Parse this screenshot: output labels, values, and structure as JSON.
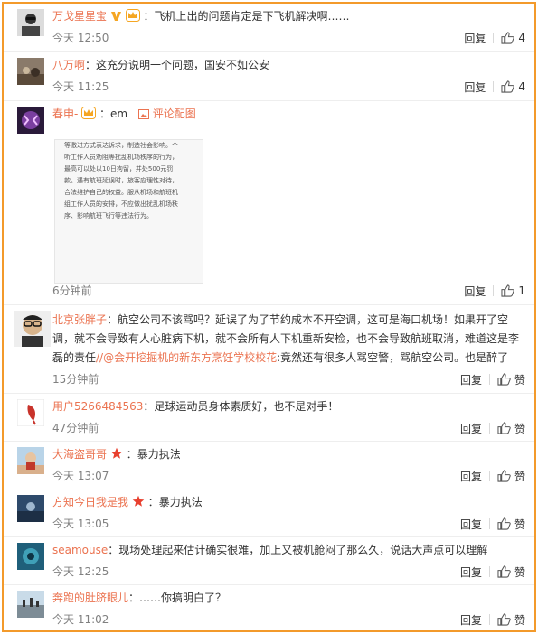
{
  "colors": {
    "frame": "#f39a2b",
    "username": "#eb7350",
    "vip_badge": "#f5a623",
    "star_badge": "#e8402f"
  },
  "comments": [
    {
      "user": "万戈星星宝",
      "sep": "：",
      "text": "飞机上出的问题肯定是下飞机解决啊……",
      "time": "今天 12:50",
      "reply": "回复",
      "likes": "4",
      "badges": [
        "vip-v-icon",
        "member-crown-icon"
      ]
    },
    {
      "user": "八万啊",
      "sep": "：",
      "text": "这充分说明一个问题，国安不如公安",
      "time": "今天 11:25",
      "reply": "回复",
      "likes": "4"
    },
    {
      "user": "春申-",
      "sep": "：",
      "text": "em",
      "pic_link": "评论配图",
      "pic_text": "等激进方式表达诉求，制造社会影响。个\n听工作人员劝阻等扰乱机场秩序的行为，\n最高可以处以10日拘留，并处500元罚\n款。遇有航班延误时，旅客应理性对待，\n合法维护自己的权益。服从机场和航班机\n组工作人员的安排，不应做出扰乱机场秩\n序、影响航班飞行等违法行为。",
      "time": "6分钟前",
      "reply": "回复",
      "likes": "1",
      "badges": [
        "member-crown-icon"
      ]
    },
    {
      "user": "北京张胖子",
      "sep": "：",
      "text": "航空公司不该骂吗？延误了为了节约成本不开空调，这可是海口机场！如果开了空调，就不会导致有人心脏病下机，就不会所有人下机重新安检，也不会导致航班取消，难道这是李磊的责任",
      "mention": "//@会开挖掘机的新东方烹饪学校校花",
      "text2": ":竟然还有很多人骂空警，骂航空公司。也是醉了",
      "time": "15分钟前",
      "reply": "回复",
      "likes": "赞"
    },
    {
      "user": "用户5266484563",
      "sep": "：",
      "text": "足球运动员身体素质好，也不是对手！",
      "time": "47分钟前",
      "reply": "回复",
      "likes": "赞"
    },
    {
      "user": "大海盗哥哥",
      "sep": "：",
      "text": "暴力执法",
      "time": "今天 13:07",
      "reply": "回复",
      "likes": "赞",
      "badges": [
        "star-badge-icon"
      ]
    },
    {
      "user": "方知今日我是我",
      "sep": "：",
      "text": "暴力执法",
      "time": "今天 13:05",
      "reply": "回复",
      "likes": "赞",
      "badges": [
        "star-badge-icon"
      ]
    },
    {
      "user": "seamouse",
      "sep": "：",
      "text": "现场处理起来估计确实很难，加上又被机舱闷了那么久，说话大声点可以理解",
      "time": "今天 12:25",
      "reply": "回复",
      "likes": "赞"
    },
    {
      "user": "奔跑的肚脐眼儿",
      "sep": "：",
      "text": "……你搞明白了？",
      "time": "今天 11:02",
      "reply": "回复",
      "likes": "赞"
    }
  ]
}
